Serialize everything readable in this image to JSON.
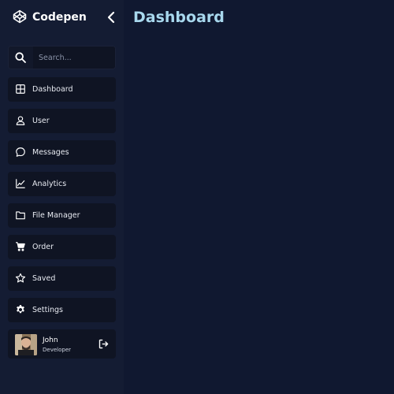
{
  "app": {
    "name": "Codepen",
    "logo_icon": "codepen-icon",
    "collapse_icon": "chevron-left-icon"
  },
  "search": {
    "placeholder": "Search...",
    "value": "",
    "icon": "search-icon"
  },
  "sidebar": {
    "items": [
      {
        "label": "Dashboard",
        "icon": "grid-icon"
      },
      {
        "label": "User",
        "icon": "user-icon"
      },
      {
        "label": "Messages",
        "icon": "chat-icon"
      },
      {
        "label": "Analytics",
        "icon": "chart-line-icon"
      },
      {
        "label": "File Manager",
        "icon": "folder-icon"
      },
      {
        "label": "Order",
        "icon": "cart-icon"
      },
      {
        "label": "Saved",
        "icon": "star-icon"
      },
      {
        "label": "Settings",
        "icon": "gear-icon"
      }
    ]
  },
  "profile": {
    "name": "John",
    "role": "Developer",
    "logout_icon": "logout-icon"
  },
  "main": {
    "title": "Dashboard"
  },
  "colors": {
    "background": "#101830",
    "sidebar": "#141c33",
    "item": "#0f1423",
    "title": "#a8d8ee",
    "text": "#e8ebf2"
  }
}
